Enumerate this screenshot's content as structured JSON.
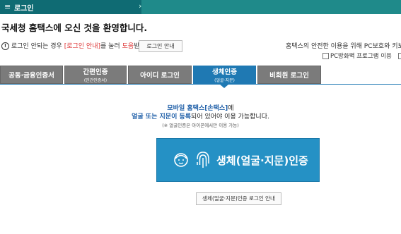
{
  "header": {
    "menu_icon": "≡",
    "title": "로그인",
    "chevron": "›"
  },
  "welcome": "국세청 홈택스에 오신 것을 환영합니다.",
  "notice": {
    "icon": "!",
    "text1": "로그인 안되는 경우 ",
    "link1": "[로그인 안내]",
    "text2": "를 눌러 ",
    "link2": "도움",
    "text3": "받으세요."
  },
  "login_guide_button": "로그인 안내",
  "right_note": "홈택스의 안전한 이용을 위해 PC보호와 키보드 보",
  "checks": {
    "firewall": "PC방화벽 프로그램 이용",
    "keyboard": "키"
  },
  "tabs": [
    {
      "label": "공동·금융인증서",
      "sub": ""
    },
    {
      "label": "간편인증",
      "sub": "(민간인증서)"
    },
    {
      "label": "아이디 로그인",
      "sub": ""
    },
    {
      "label": "생체인증",
      "sub": "(얼굴·지문)"
    },
    {
      "label": "비회원 로그인",
      "sub": ""
    }
  ],
  "desc": {
    "l1_blue": "모바일 홈택스[손택스]",
    "l1_rest": "에",
    "l2_blue": "얼굴 또는 지문이 등록",
    "l2_rest": "되어 있어야 이용 가능합니다.",
    "l3": "(※ 얼굴인증은 아이폰에서만 이용 가능)"
  },
  "bio_button": "생체(얼굴·지문)인증",
  "bio_guide_button": "생체(얼굴·지문)인증 로그인 안내",
  "colors": {
    "header": "#1f8a8a",
    "active_tab": "#1f79b3",
    "tab": "#7b7b7b",
    "bio_button": "#2591c5"
  }
}
